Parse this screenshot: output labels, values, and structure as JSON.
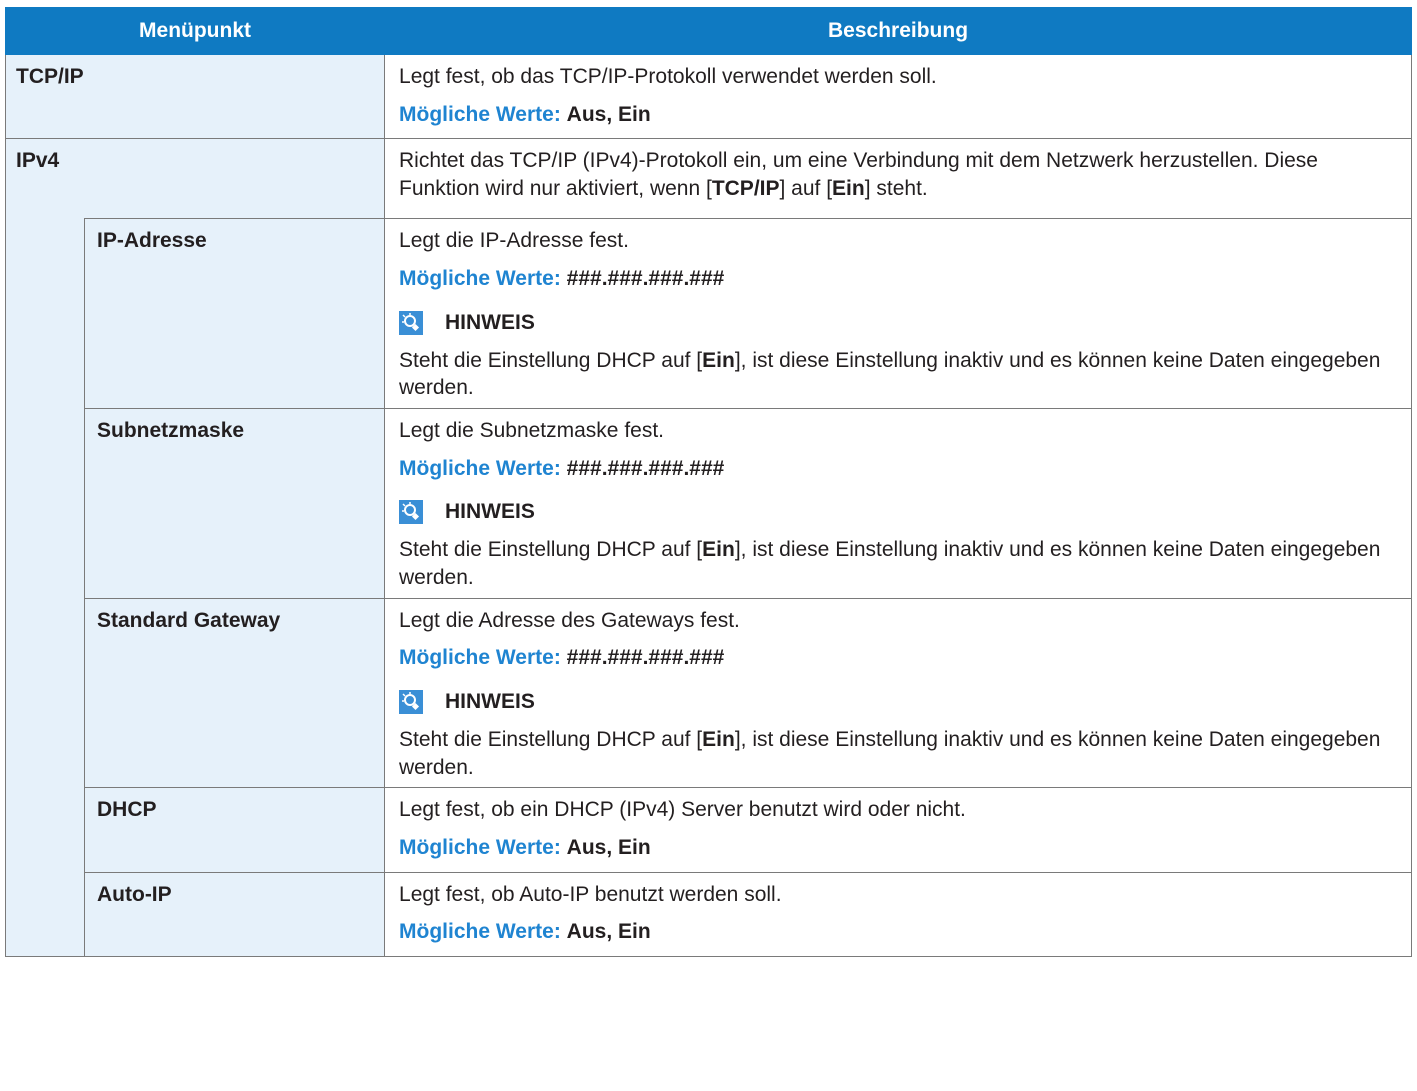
{
  "header": {
    "col1": "Menüpunkt",
    "col2": "Beschreibung"
  },
  "common": {
    "values_label": "Mögliche Werte:",
    "note_title": "HINWEIS",
    "dhcp_note": {
      "p1": "Steht die Einstellung DHCP auf [",
      "b1": "Ein",
      "p2": "], ist diese Einstellung inaktiv und es können keine Daten eingegeben werden."
    }
  },
  "rows": {
    "tcpip": {
      "name": "TCP/IP",
      "desc": "Legt fest, ob das TCP/IP-Protokoll verwendet werden soll.",
      "values": "Aus, Ein"
    },
    "ipv4": {
      "name": "IPv4",
      "desc": {
        "p1": "Richtet das TCP/IP (IPv4)-Protokoll ein, um eine Verbindung mit dem Netzwerk herzustellen. Diese Funktion wird nur aktiviert, wenn [",
        "b1": "TCP/IP",
        "p2": "] auf [",
        "b2": "Ein",
        "p3": "] steht."
      }
    },
    "ip_address": {
      "name": "IP-Adresse",
      "desc": "Legt die IP-Adresse fest.",
      "values": "###.###.###.###"
    },
    "subnet": {
      "name": "Subnetzmaske",
      "desc": "Legt die Subnetzmaske fest.",
      "values": "###.###.###.###"
    },
    "gateway": {
      "name": "Standard Gateway",
      "desc": "Legt die Adresse des Gateways fest.",
      "values": "###.###.###.###"
    },
    "dhcp": {
      "name": "DHCP",
      "desc": "Legt fest, ob ein DHCP (IPv4) Server benutzt wird oder nicht.",
      "values": "Aus, Ein"
    },
    "auto_ip": {
      "name": "Auto-IP",
      "desc": "Legt fest, ob Auto-IP benutzt werden soll.",
      "values": "Aus, Ein"
    }
  },
  "colors": {
    "header_bg": "#0f7ac2",
    "menu_bg": "#e6f1fa",
    "value_label": "#1f84d1"
  },
  "icons": {
    "note": "lightbulb-note-icon"
  }
}
